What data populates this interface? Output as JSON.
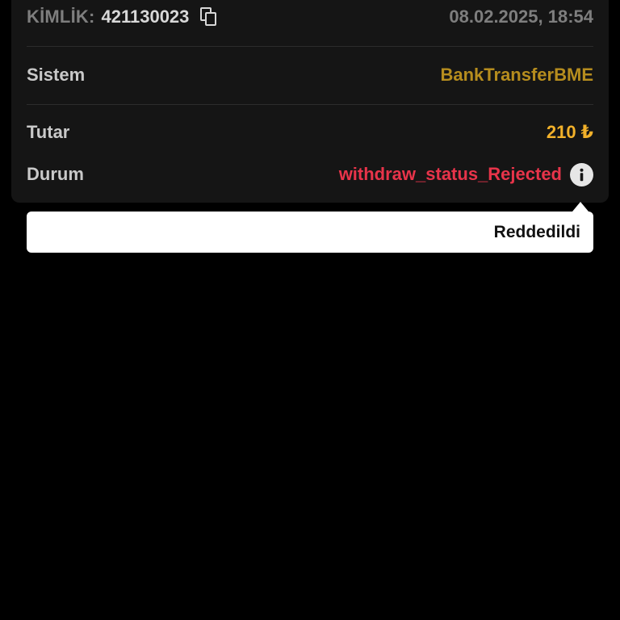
{
  "transaction": {
    "id_label": "KİMLİK:",
    "id_value": "421130023",
    "datetime": "08.02.2025, 18:54",
    "system_label": "Sistem",
    "system_value": "BankTransferBME",
    "amount_label": "Tutar",
    "amount_value": "210 ₺",
    "status_label": "Durum",
    "status_value": "withdraw_status_Rejected"
  },
  "tooltip": {
    "text": "Reddedildi"
  },
  "icons": {
    "copy": "copy-icon",
    "info": "info-icon"
  },
  "colors": {
    "background": "#000000",
    "card": "#151515",
    "system_value": "#b68d1e",
    "amount_value": "#f2b12a",
    "status_rejected": "#e8344a",
    "tooltip_bg": "#ffffff"
  }
}
